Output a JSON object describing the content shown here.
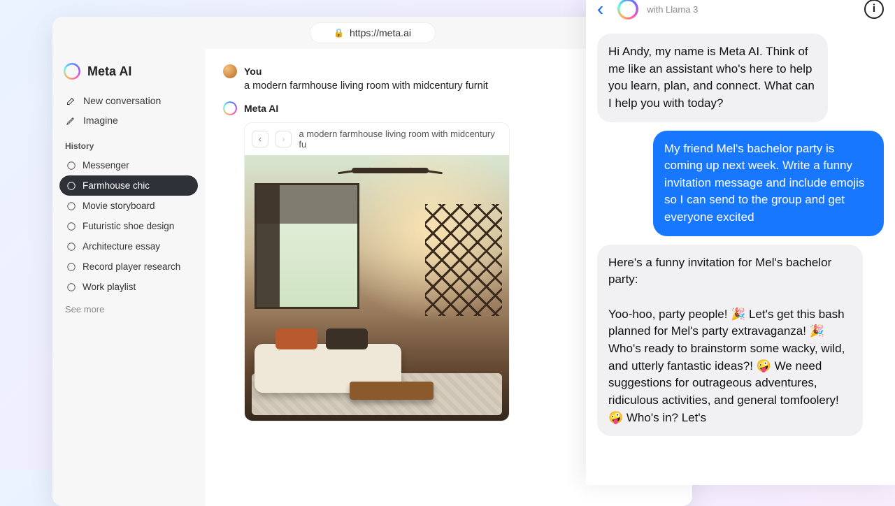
{
  "browser": {
    "url": "https://meta.ai"
  },
  "sidebar": {
    "brand": "Meta AI",
    "new_conversation": "New conversation",
    "imagine": "Imagine",
    "history_label": "History",
    "see_more": "See more",
    "history": [
      {
        "label": "Messenger"
      },
      {
        "label": "Farmhouse chic"
      },
      {
        "label": "Movie storyboard"
      },
      {
        "label": "Futuristic shoe design"
      },
      {
        "label": "Architecture essay"
      },
      {
        "label": "Record player research"
      },
      {
        "label": "Work playlist"
      }
    ]
  },
  "conversation": {
    "user_name": "You",
    "user_prompt": "a modern farmhouse living room with midcentury furnit",
    "ai_name": "Meta AI",
    "image_caption": "a modern farmhouse living room with midcentury fu"
  },
  "mobile": {
    "subtitle": "with Llama 3",
    "info_glyph": "i",
    "messages": {
      "ai_greeting": "Hi Andy, my name is Meta AI. Think of me like an assistant who's here to help you learn, plan, and connect. What can I help you with today?",
      "user_request": "My friend Mel's bachelor party is coming up next week. Write a funny invitation message and include emojis so I can send to the group and get everyone excited",
      "ai_response": "Here's a funny invitation for Mel's bachelor party:\n\nYoo-hoo, party people! 🎉 Let's get this bash planned for Mel's party extravaganza! 🎉 Who's ready to brainstorm some wacky, wild, and utterly fantastic ideas?! 🤪 We need suggestions for outrageous adventures, ridiculous activities, and general tomfoolery! 🤪 Who's in? Let's"
    }
  }
}
